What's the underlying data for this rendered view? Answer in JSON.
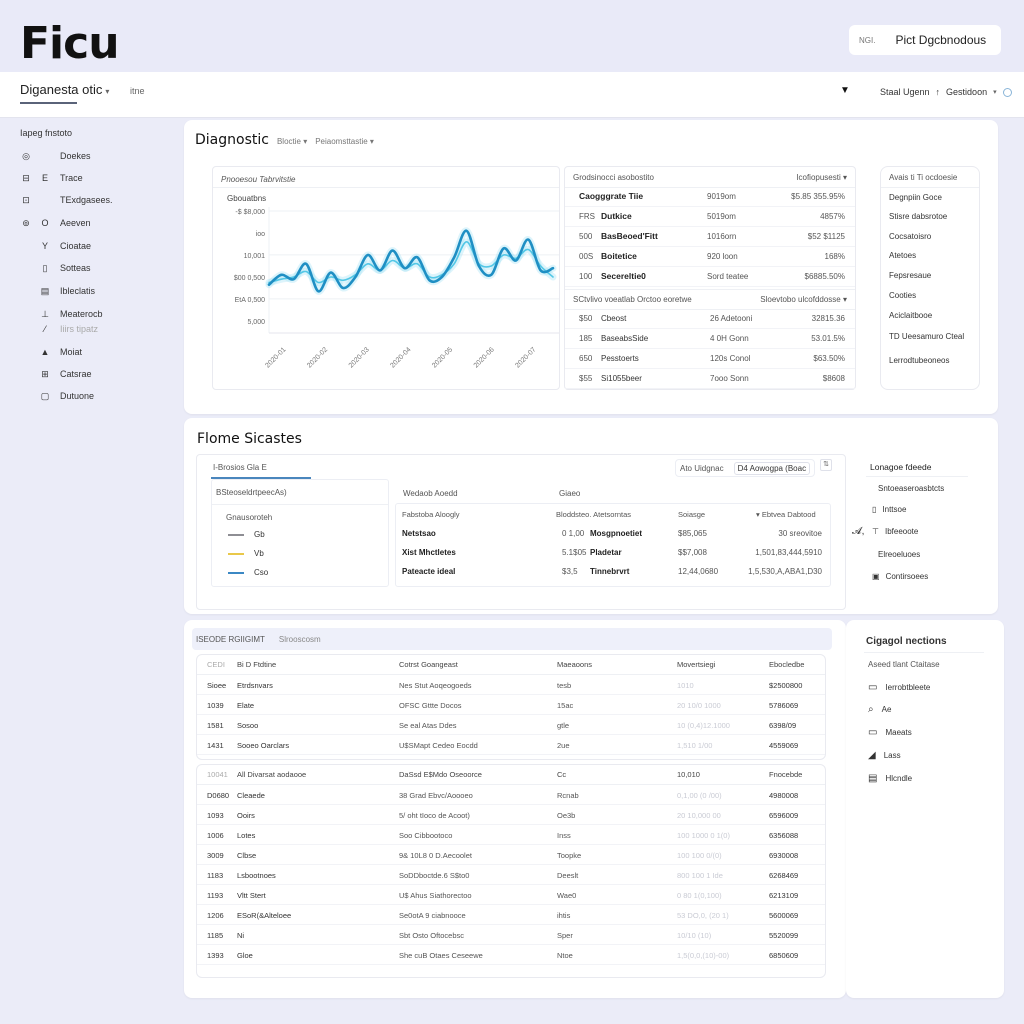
{
  "app": {
    "logo": "Ficu",
    "user": {
      "tag": "NGI.",
      "name": "Pict Dgcbnodous"
    }
  },
  "navbar": {
    "title": "Diganesta otic",
    "sub": "itne",
    "right_a": "Staal Ugenn",
    "right_sep": "↑",
    "right_b": "Gestidoon"
  },
  "sidebar": {
    "title": "Iapeg fnstoto",
    "items": [
      {
        "icon1": "◎",
        "icon2": "",
        "label": "Doekes",
        "dim": false
      },
      {
        "icon1": "⊟",
        "icon2": "E",
        "label": "Trace",
        "dim": false
      },
      {
        "icon1": "⊡",
        "icon2": "",
        "label": "TExdgasees.",
        "dim": false
      },
      {
        "icon1": "⊚",
        "icon2": "O",
        "label": "Aeeven",
        "dim": false
      },
      {
        "icon1": "",
        "icon2": "Y",
        "label": "Cioatae",
        "dim": false
      },
      {
        "icon1": "",
        "icon2": "▯",
        "label": "Sotteas",
        "dim": false
      },
      {
        "icon1": "",
        "icon2": "▤",
        "label": "Ibleclatis",
        "dim": false
      },
      {
        "icon1": "",
        "icon2": "⊥",
        "label": "Meaterocb",
        "dim": false
      },
      {
        "icon1": "",
        "icon2": "⁄",
        "label": "Iiirs tipatz",
        "dim": true
      },
      {
        "icon1": "",
        "icon2": "▲",
        "label": "Moiat",
        "dim": false
      },
      {
        "icon1": "",
        "icon2": "⊞",
        "label": "Catsrae",
        "dim": false
      },
      {
        "icon1": "",
        "icon2": "▢",
        "label": "Dutuone",
        "dim": false
      }
    ]
  },
  "diagnostic": {
    "title": "Diagnostic",
    "dropdown1": "Bloctie",
    "dropdown2": "Peiaomsttastie",
    "chart_panel_title": "Pnooesou Tabrvitstie",
    "chart_data": {
      "type": "line",
      "title": "Gbouatbns",
      "xlabel": "",
      "ylabel": "",
      "y_tick_labels": [
        "-$ $8,000",
        "ioo",
        "10,001",
        "$00 0,500",
        "EtA 0,500",
        "5,000"
      ],
      "x_tick_labels": [
        "2020-01",
        "2020-02",
        "2020-03",
        "2020-04",
        "2020-05",
        "2020-06",
        "2020-07"
      ],
      "ylim": [
        0,
        100
      ],
      "grid": true,
      "series": [
        {
          "name": "primary",
          "color": "#1f8fc4",
          "values": [
            33,
            42,
            38,
            52,
            27,
            44,
            30,
            40,
            60,
            46,
            64,
            48,
            58,
            37,
            40,
            58,
            82,
            50,
            42,
            66,
            55,
            74,
            46,
            48
          ]
        },
        {
          "name": "secondary",
          "color": "#53c7e6",
          "values": [
            35,
            38,
            40,
            45,
            35,
            40,
            37,
            42,
            52,
            46,
            55,
            48,
            52,
            40,
            42,
            52,
            72,
            52,
            50,
            60,
            57,
            65,
            50,
            40
          ]
        }
      ]
    },
    "metrics": {
      "header_left": "Grodsinocci asobostito",
      "header_right": "Icofiopusesti",
      "rows": [
        {
          "code": "",
          "name": "Caogggrate Tiie",
          "mid": "9019om",
          "val": "$5.85 355.95%"
        },
        {
          "code": "FRS",
          "name": "Dutkice",
          "mid": "5019om",
          "val": "4857%"
        },
        {
          "code": "500",
          "name": "BasBeoed'Fitt",
          "mid": "1016orn",
          "val": "$52 $1125"
        },
        {
          "code": "00S",
          "name": "Boitetice",
          "mid": "920 loon",
          "val": "168%"
        },
        {
          "code": "100",
          "name": "Secereltie0",
          "mid": "Sord teatee",
          "val": "$6885.50%"
        }
      ],
      "header2_left": "SCtvlivo voeatlab Orctoo eoretwe",
      "header2_right": "Sloevtobo ulcofddosse",
      "rows2": [
        {
          "code": "$50",
          "name": "Cbeost",
          "mid": "26 Adetooni",
          "val": "32815.36"
        },
        {
          "code": "185",
          "name": "BaseabsSide",
          "mid": "4 0H Gonn",
          "val": "53.01.5%"
        },
        {
          "code": "650",
          "name": "Pesstoerts",
          "mid": "120s Conol",
          "val": "$63.50%"
        },
        {
          "code": "$55",
          "name": "Si1055beer",
          "mid": "7ooo Sonn",
          "val": "$8608"
        }
      ]
    },
    "right_list": {
      "header": "Avais ti Ti ocdoesie",
      "items": [
        "Degnpiin Goce",
        "Stisre dabsrotoe",
        "Cocsatoisro",
        "Atetoes",
        "Fepsresaue",
        "Cooties",
        "Aciclaitbooe",
        "TD  Ueesamuro Cteal",
        "Lerrodtubeoneos"
      ]
    }
  },
  "flow": {
    "title": "Flome Sicastes",
    "tab_label": "I-Brosios Gla E",
    "filter_a": "Ato Uidgnac",
    "filter_b": "D4 Aowogpa (Boac",
    "legend_panel": {
      "header": "BSteoseldrtpeecAs)",
      "sub": "Gnausoroteh",
      "items": [
        {
          "color": "#8e8e94",
          "label": "Gb"
        },
        {
          "color": "#e9c84a",
          "label": "Vb"
        },
        {
          "color": "#3b88c4",
          "label": "Cso"
        }
      ]
    },
    "table": {
      "header_left": "Wedaob Aoedd",
      "header_mid": "Giaeo",
      "columns": [
        "Fabstoba Aloogly",
        "Bloddsteo. Atetsorntas",
        "Soiasge",
        "▾ Ebtvea Dabtood"
      ],
      "rows": [
        [
          "Netstsao",
          "0 1,00",
          "Mosgpnoetiet",
          "$85,065",
          "30 sreovitoe"
        ],
        [
          "Xist Mhctletes",
          "5.1$05",
          "Pladetar",
          "$$7,008",
          "1,501,83,444,5910"
        ],
        [
          "Pateacte ideal",
          "$3,5",
          "Tinnebrvrt",
          "12,44,0680",
          "1,5,530,A,ABA1,D30"
        ]
      ]
    },
    "side": {
      "header": "Lonagoe fdeede",
      "items": [
        {
          "icon": "",
          "label": "Sntoeaseroasbtcts"
        },
        {
          "icon": "▯",
          "label": "Inttsoe"
        },
        {
          "icon": "⊤",
          "label": "Ibfeeoote",
          "lead": "𝓐,"
        },
        {
          "icon": "",
          "label": "Elreoeluoes"
        },
        {
          "icon": "▣",
          "label": "Contirsoees"
        }
      ]
    }
  },
  "records": {
    "header_a": "ISEODE RGIIGIMT",
    "header_b": "Slrooscosm",
    "table1": {
      "columns": [
        "CEDI",
        "Bi D Ftdtine",
        "Cotrst Goangeast",
        "Maeaoons",
        "Movertsiegi",
        "Ebocledbe"
      ],
      "rows": [
        [
          "Sioee",
          "Etrdsnvars",
          "Nes Stut Aoqeogoeds",
          "tesb",
          "1010",
          "$2500800"
        ],
        [
          "1039",
          "Elate",
          "OFSC Gttte Docos",
          "15ac",
          "20 10/0 1000",
          "5786069"
        ],
        [
          "1581",
          "Sosoo",
          "Se eal Atas Ddes",
          "gtle",
          "10 (0,4)12.1000",
          "6398/09"
        ],
        [
          "1431",
          "Sooeo Oarclars",
          "U$SMapt Cedeo Eocdd",
          "2ue",
          "1,510 1/00",
          "4559069"
        ]
      ]
    },
    "table2": {
      "columns": [
        "10041",
        "All Divarsat aodaooe",
        "DaSsd E$Mdo Oseoorce",
        "Cc",
        "10,010",
        "Fnocebde"
      ],
      "rows": [
        [
          "D0680",
          "Cleaede",
          "38 Grad Ebvc/Aoooeo",
          "Rcnab",
          "0,1,00 (0 /00)",
          "4980008"
        ],
        [
          "1093",
          "Ooirs",
          "5/ oht tIoco de Acoot)",
          "Oe3b",
          "20 10,000 00",
          "6596009"
        ],
        [
          "1006",
          "Lotes",
          "Soo Cibbootoco",
          "Inss",
          "100 1000 0 1(0)",
          "6356088"
        ],
        [
          "3009",
          "Clbse",
          "9& 10L8 0 D.Aecoolet",
          "Toopke",
          "100 100 0/(0)",
          "6930008"
        ],
        [
          "1183",
          "Lsbootnoes",
          "SoDDboctde.6 S$to0",
          "Deeslt",
          "800 100 1 Ide",
          "6268469"
        ],
        [
          "1193",
          "Vltt Stert",
          "U$ Ahus Siathorectoo",
          "Wae0",
          "0 80 1(0,100)",
          "6213109"
        ],
        [
          "1206",
          "ESoR(&Alteloee",
          "Se0otA 9 ciabnooce",
          "ihtis",
          "53 DO,0, (20 1)",
          "5600069"
        ],
        [
          "1185",
          "Ni",
          "Sbt Osto Oftocebsc",
          "Sper",
          "10/10 (10)",
          "5520099"
        ],
        [
          "1393",
          "Gloe",
          "She cuB Otaes Ceseewe",
          "Ntoe",
          "1,5(0,0,(10)-00)",
          "6850609"
        ]
      ]
    },
    "side": {
      "header": "Cigagol nections",
      "sub": "Aseed tlant Ctaitase",
      "items": [
        {
          "icon": "▭",
          "label": "Ierrobtbleete"
        },
        {
          "icon": "⌕",
          "label": "Ae"
        },
        {
          "icon": "▭",
          "label": "Maeats"
        },
        {
          "icon": "◢",
          "label": "Lass"
        },
        {
          "icon": "▤",
          "label": "Hlcndle"
        }
      ]
    }
  }
}
